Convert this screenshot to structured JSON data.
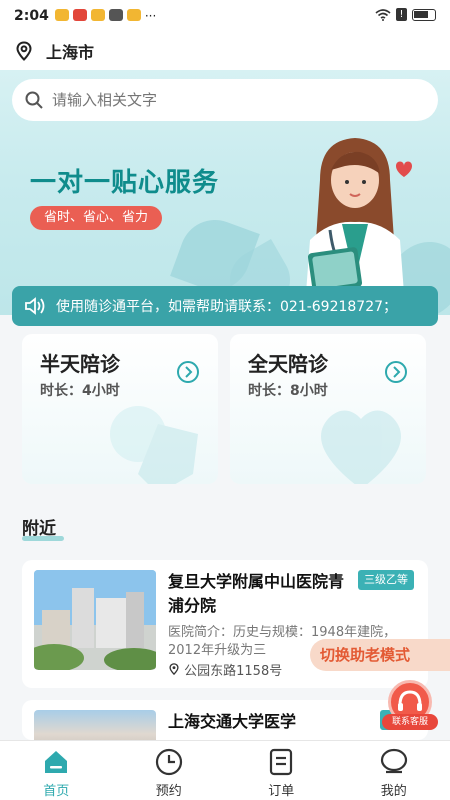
{
  "status_bar": {
    "time": "2:04",
    "dots": "···"
  },
  "location": {
    "city": "上海市",
    "icon": "location-pin-icon"
  },
  "search": {
    "placeholder": "请输入相关文字",
    "icon": "search-icon"
  },
  "banner": {
    "title": "一对一贴心服务",
    "tag": "省时、省心、省力"
  },
  "notice": {
    "icon": "speaker-icon",
    "text": "使用随诊通平台，如需帮助请联系：021-69218727；"
  },
  "services": [
    {
      "title": "半天陪诊",
      "duration": "时长：4小时"
    },
    {
      "title": "全天陪诊",
      "duration": "时长：8小时"
    }
  ],
  "nearby": {
    "title": "附近"
  },
  "hospitals": [
    {
      "name": "复旦大学附属中山医院青浦分院",
      "level": "三级乙等",
      "desc": "医院简介：历史与规模：1948年建院，2012年升级为三",
      "address": "公园东路1158号"
    },
    {
      "name": "上海交通大学医学",
      "level": "三级"
    }
  ],
  "floating": {
    "senior_mode": "切换助老模式",
    "customer_service": "联系客服"
  },
  "nav": [
    {
      "label": "首页",
      "icon": "home-icon",
      "active": true
    },
    {
      "label": "预约",
      "icon": "clock-icon",
      "active": false
    },
    {
      "label": "订单",
      "icon": "order-icon",
      "active": false
    },
    {
      "label": "我的",
      "icon": "profile-icon",
      "active": false
    }
  ],
  "colors": {
    "primary": "#2ea9ae",
    "notice_bg": "#3aa3a8",
    "accent_red": "#ea5f53",
    "senior_orange": "#e35a34"
  }
}
